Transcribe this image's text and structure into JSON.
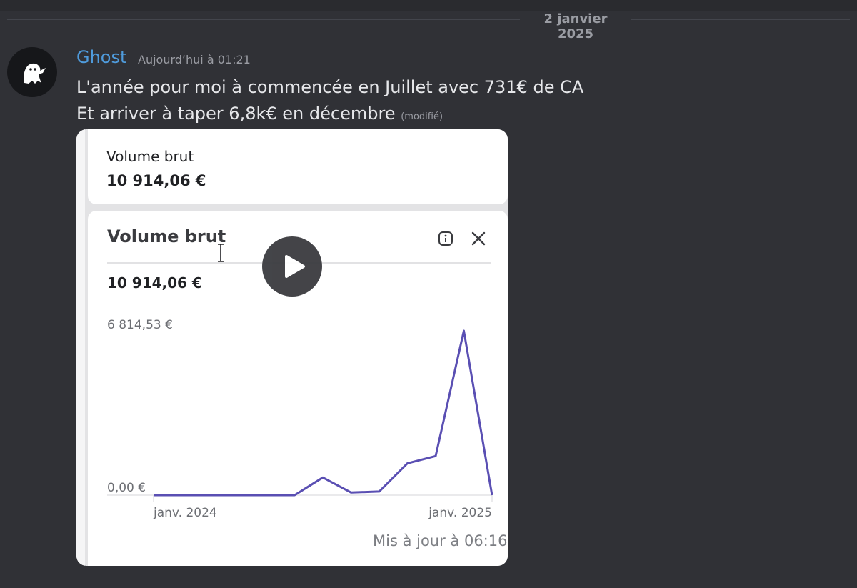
{
  "chat": {
    "date_divider": "2 janvier 2025",
    "message": {
      "author": "Ghost",
      "author_color": "#4f9bdc",
      "timestamp": "Aujourd’hui à 01:21",
      "line1": "L'année pour moi à commencée en Juillet avec 731€ de CA",
      "line2": "Et arriver à taper 6,8k€ en décembre",
      "edited_label": "(modifié)",
      "avatar_icon": "ghost-icon"
    }
  },
  "embed": {
    "summary_label": "Volume brut",
    "summary_value": "10 914,06 €",
    "panel": {
      "title": "Volume brut",
      "value": "10 914,06 €",
      "info_icon": "info-icon",
      "close_icon": "close-icon",
      "updated": "Mis à jour à 06:16"
    },
    "video_overlay_icon": "play-icon"
  },
  "chart_data": {
    "type": "line",
    "x": [
      "2024-01",
      "2024-02",
      "2024-03",
      "2024-04",
      "2024-05",
      "2024-06",
      "2024-07",
      "2024-08",
      "2024-09",
      "2024-10",
      "2024-11",
      "2024-12",
      "2025-01"
    ],
    "series": [
      {
        "values": [
          0,
          0,
          0,
          0,
          0,
          0,
          731,
          110,
          150,
          1320,
          1620,
          6814.53,
          0
        ],
        "color": "#5a4fb3"
      }
    ],
    "y_tick_labels": [
      "6 814,53 €",
      "0,00 €"
    ],
    "y_ticks": [
      6814.53,
      0
    ],
    "x_tick_labels": [
      "janv. 2024",
      "janv. 2025"
    ],
    "ylim": [
      0,
      6814.53
    ],
    "grid": false
  }
}
